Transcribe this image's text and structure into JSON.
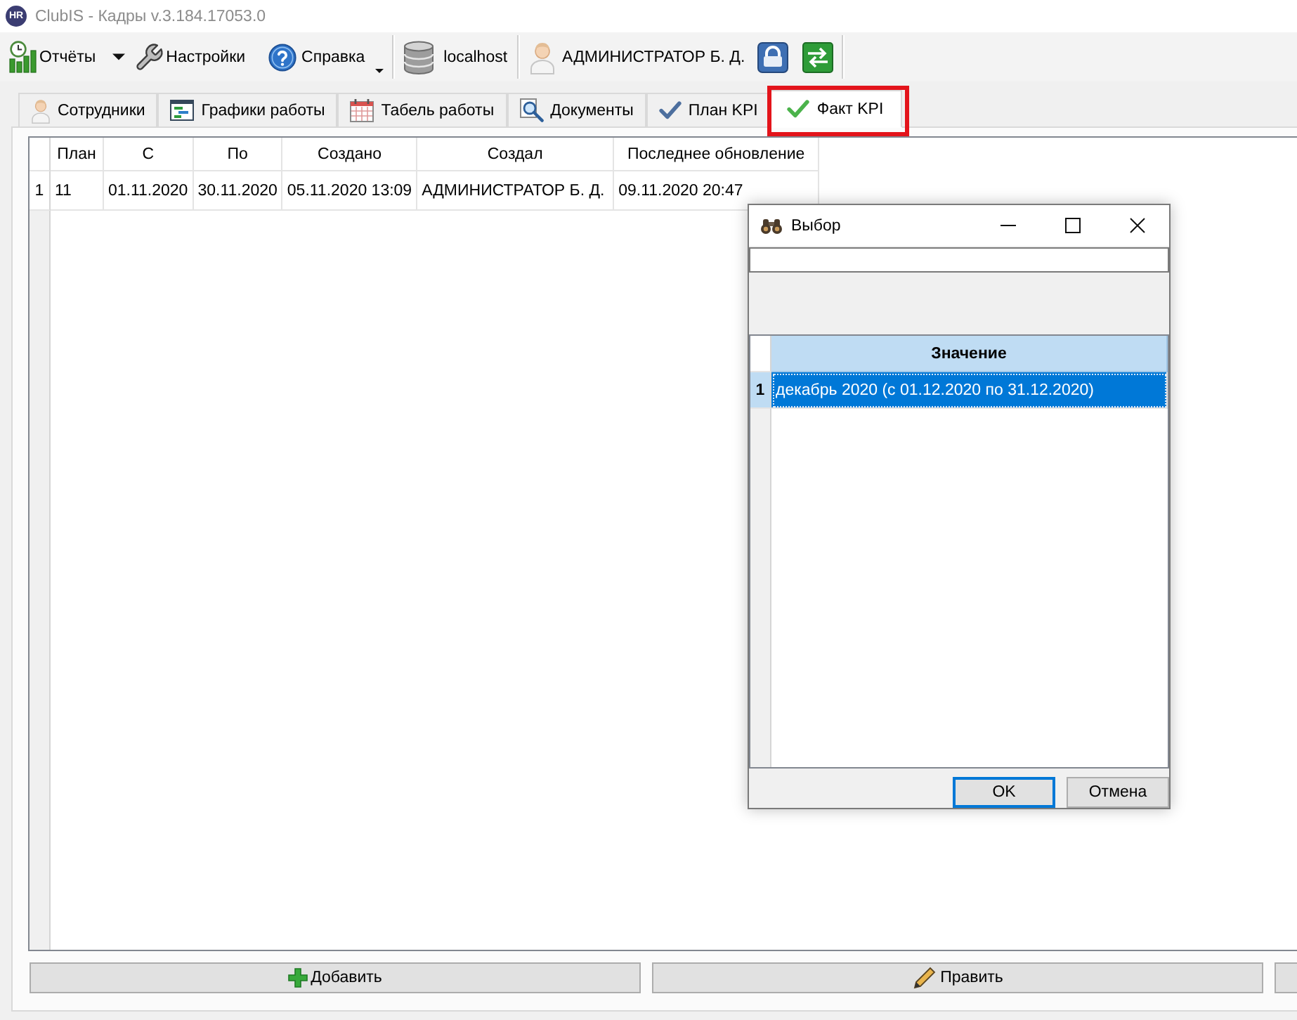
{
  "window": {
    "logo": "HR",
    "title": "ClubIS - Кадры v.3.184.17053.0"
  },
  "toolbar": {
    "reports": {
      "label": "Отчёты"
    },
    "settings": {
      "label": "Настройки"
    },
    "help": {
      "label": "Справка"
    },
    "server": {
      "label": "localhost"
    },
    "user": {
      "label": "АДМИНИСТРАТОР Б. Д."
    }
  },
  "tabs": [
    {
      "label": "Сотрудники",
      "selected": false,
      "highlighted": false
    },
    {
      "label": "Графики работы",
      "selected": false,
      "highlighted": false
    },
    {
      "label": "Табель работы",
      "selected": false,
      "highlighted": false
    },
    {
      "label": "Документы",
      "selected": false,
      "highlighted": false
    },
    {
      "label": "План KPI",
      "selected": false,
      "highlighted": false
    },
    {
      "label": "Факт KPI",
      "selected": true,
      "highlighted": true
    }
  ],
  "table": {
    "columns": [
      "План",
      "С",
      "По",
      "Создано",
      "Создал",
      "Последнее обновление"
    ],
    "rows": [
      {
        "number": "1",
        "selected": false,
        "cells": [
          "11",
          "01.11.2020",
          "30.11.2020",
          "05.11.2020 13:09",
          "АДМИНИСТРАТОР Б. Д.",
          "09.11.2020 20:47"
        ]
      }
    ]
  },
  "actions": [
    {
      "label": "Добавить"
    },
    {
      "label": "Править"
    }
  ],
  "dialog": {
    "title": "Выбор",
    "table": {
      "columns": [
        "Значение"
      ],
      "rows": [
        {
          "number": "1",
          "selected": true,
          "cells": [
            "декабрь 2020 (с 01.12.2020 по 31.12.2020)"
          ]
        }
      ]
    },
    "buttons": [
      {
        "label": "OK",
        "default": true
      },
      {
        "label": "Отмена",
        "default": false
      }
    ]
  }
}
